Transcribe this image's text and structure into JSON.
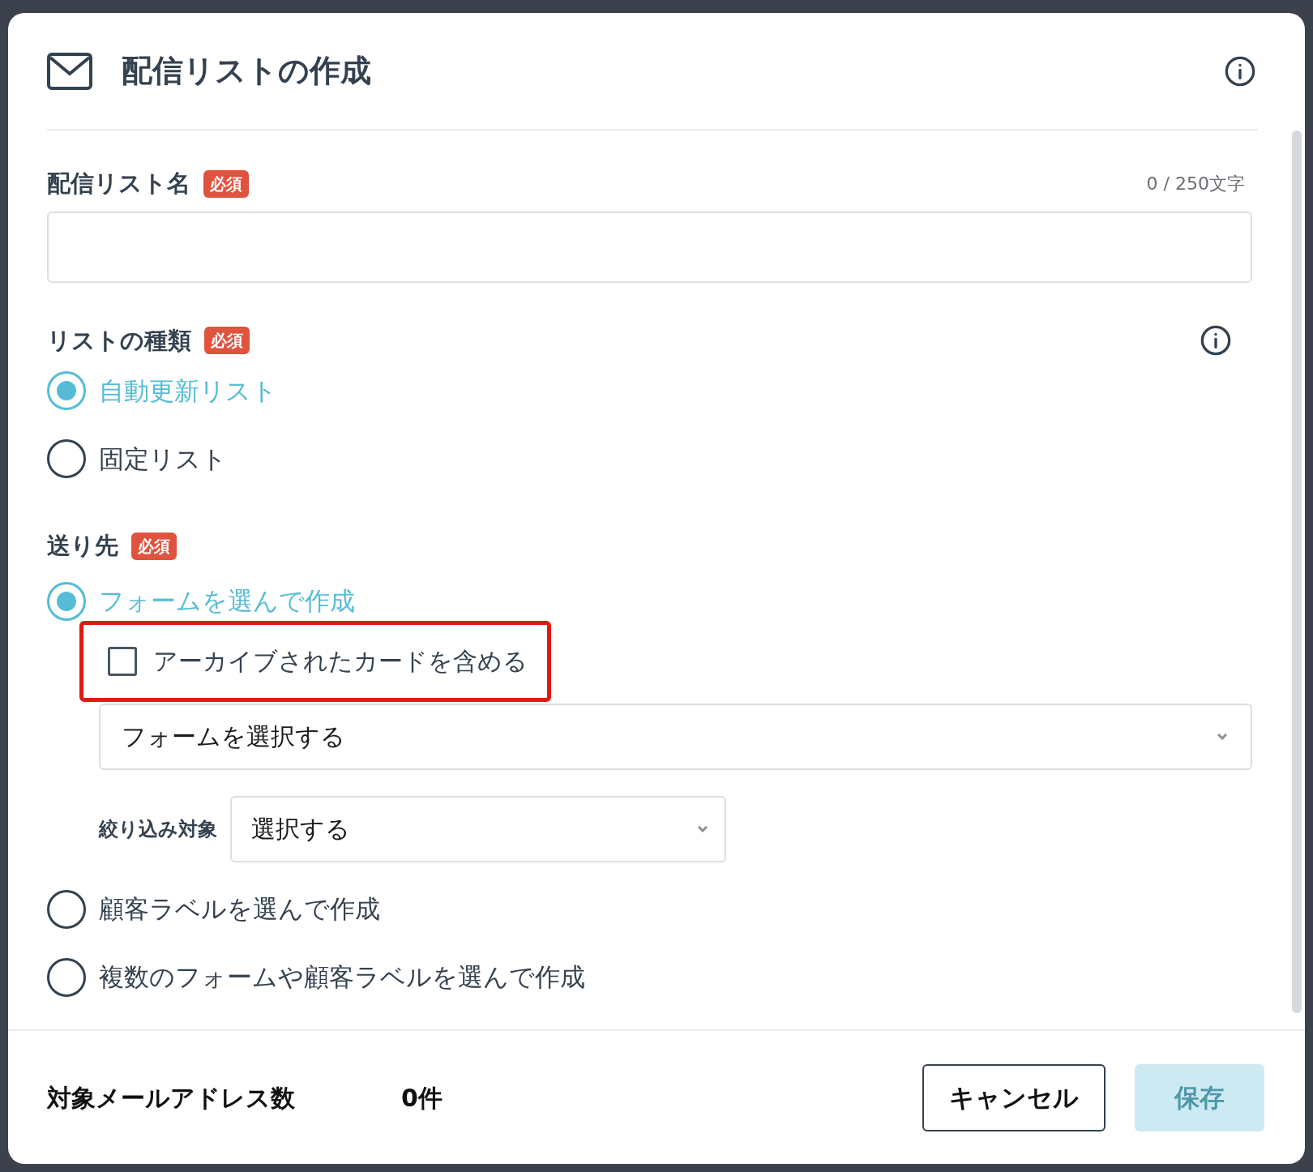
{
  "dialog": {
    "title": "配信リストの作成"
  },
  "name_field": {
    "label": "配信リスト名",
    "badge": "必須",
    "counter": "0 / 250文字"
  },
  "list_type": {
    "label": "リストの種類",
    "badge": "必須",
    "options": [
      {
        "label": "自動更新リスト",
        "selected": true
      },
      {
        "label": "固定リスト",
        "selected": false
      }
    ]
  },
  "recipients": {
    "label": "送り先",
    "badge": "必須",
    "options": [
      {
        "label": "フォームを選んで作成",
        "selected": true,
        "archived_checkbox": {
          "label": "アーカイブされたカードを含める",
          "checked": false,
          "highlighted": true
        },
        "form_select": {
          "value": "フォームを選択する"
        },
        "filter": {
          "label": "絞り込み対象",
          "value": "選択する"
        }
      },
      {
        "label": "顧客ラベルを選んで作成",
        "selected": false
      },
      {
        "label": "複数のフォームや顧客ラベルを選んで作成",
        "selected": false
      }
    ]
  },
  "footer": {
    "count_label": "対象メールアドレス数",
    "count": "0件",
    "buttons": [
      {
        "label": "キャンセル",
        "kind": "secondary",
        "disabled": false
      },
      {
        "label": "保存",
        "kind": "primary",
        "disabled": true
      }
    ]
  }
}
